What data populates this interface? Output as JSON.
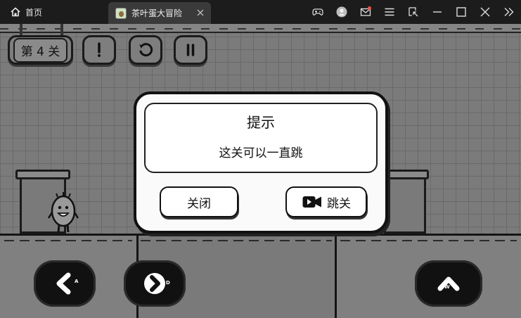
{
  "titlebar": {
    "home_label": "首页",
    "tab_title": "茶叶蛋大冒险",
    "icons": [
      "gamepad-icon",
      "avatar-icon",
      "mail-icon",
      "menu-icon",
      "screenshot-icon",
      "minimize-icon",
      "maximize-icon",
      "close-icon",
      "more-icon"
    ],
    "mail_badge_color": "#ff4d3d"
  },
  "hud": {
    "level_label": "第 4 关",
    "hint_icon": "exclamation-icon",
    "restart_icon": "restart-icon",
    "pause_icon": "pause-icon"
  },
  "dialog": {
    "title": "提示",
    "message": "这关可以一直跳",
    "close_label": "关闭",
    "skip_label": "跳关",
    "skip_icon": "video-icon"
  },
  "controls": {
    "left_key": "A",
    "right_key": "D",
    "jump_key": "W"
  }
}
